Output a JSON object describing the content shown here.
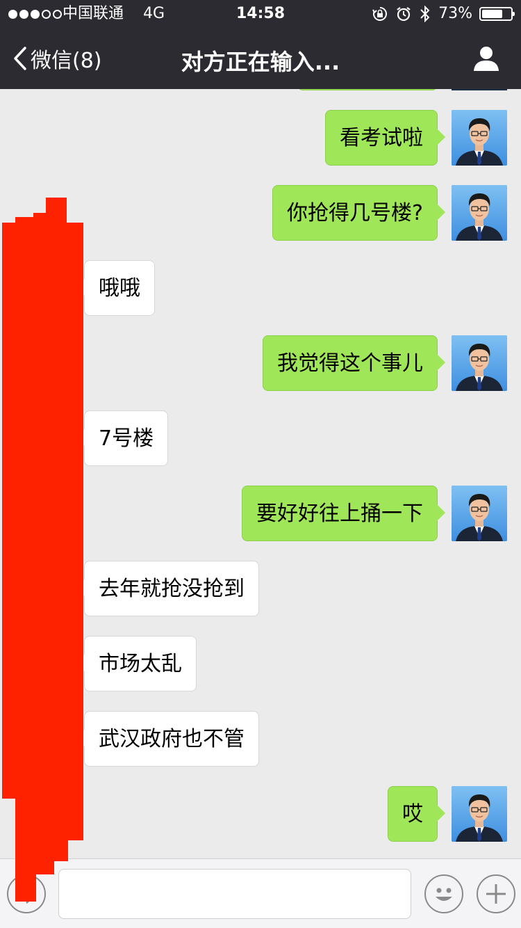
{
  "status_bar": {
    "signal_dots_filled": 3,
    "signal_dots_total": 5,
    "carrier": "中国联通",
    "network": "4G",
    "time": "14:58",
    "battery_text": "73%",
    "battery_level": 0.73,
    "icons": [
      "orientation-lock-icon",
      "alarm-icon",
      "bluetooth-icon",
      "battery-icon"
    ]
  },
  "nav": {
    "back_label": "微信(8)",
    "title": "对方正在输入...",
    "right_icon": "profile-icon"
  },
  "messages": [
    {
      "side": "right",
      "text": "看考试啦"
    },
    {
      "side": "right",
      "text": "你抢得几号楼?"
    },
    {
      "side": "left",
      "text": "哦哦"
    },
    {
      "side": "right",
      "text": "我觉得这个事儿"
    },
    {
      "side": "left",
      "text": "7号楼"
    },
    {
      "side": "right",
      "text": "要好好往上捅一下"
    },
    {
      "side": "left",
      "text": "去年就抢没抢到"
    },
    {
      "side": "left",
      "text": "市场太乱"
    },
    {
      "side": "left",
      "text": "武汉政府也不管"
    },
    {
      "side": "right",
      "text": "哎"
    }
  ],
  "input_bar": {
    "left_icon": "voice-icon",
    "input_value": "",
    "emoji_icon": "emoji-icon",
    "plus_icon": "plus-icon"
  },
  "colors": {
    "nav_bg": "#2b2b31",
    "chat_bg": "#ebebeb",
    "my_bubble": "#9fe658",
    "their_bubble": "#ffffff",
    "redaction": "#ff2200"
  }
}
